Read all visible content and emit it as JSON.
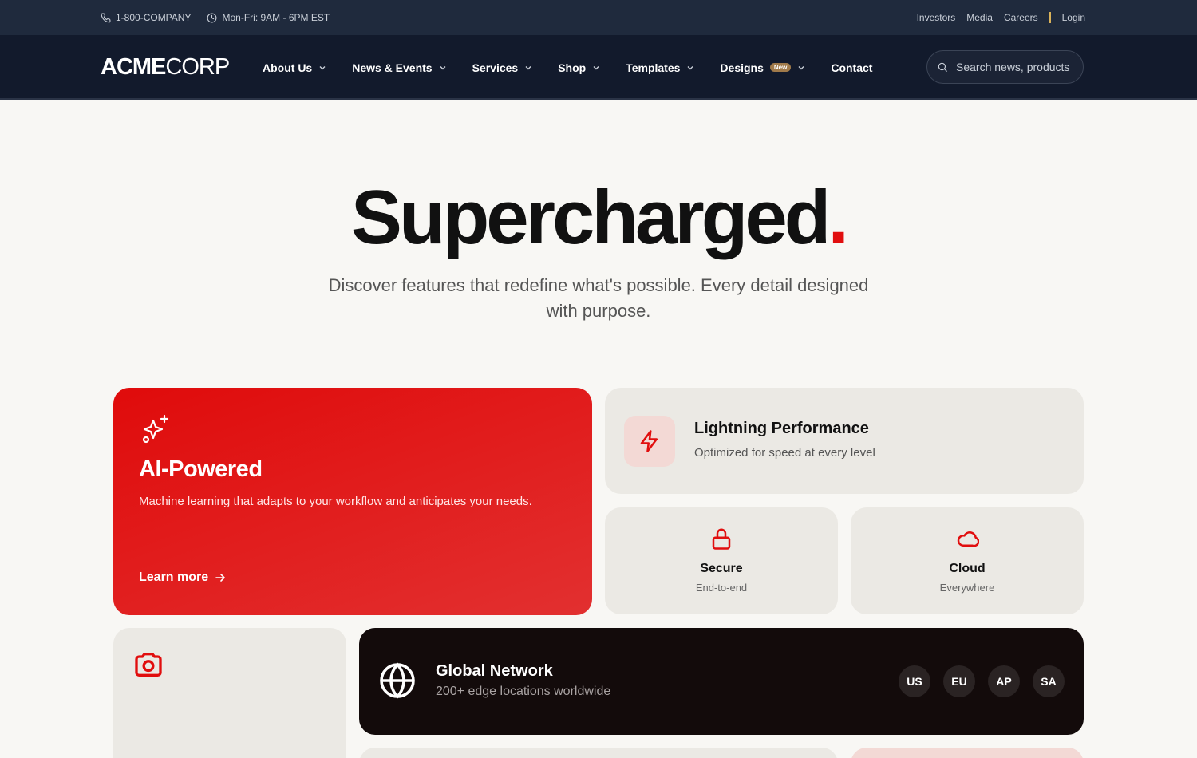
{
  "utility": {
    "phone": "1-800-COMPANY",
    "hours": "Mon-Fri: 9AM - 6PM EST",
    "links": [
      "Investors",
      "Media",
      "Careers"
    ],
    "login": "Login"
  },
  "nav": {
    "logo_bold": "ACME",
    "logo_light": "CORP",
    "items": [
      {
        "label": "About Us",
        "dropdown": true
      },
      {
        "label": "News & Events",
        "dropdown": true
      },
      {
        "label": "Services",
        "dropdown": true
      },
      {
        "label": "Shop",
        "dropdown": true
      },
      {
        "label": "Templates",
        "dropdown": true
      },
      {
        "label": "Designs",
        "dropdown": true,
        "badge": "New"
      },
      {
        "label": "Contact",
        "dropdown": false
      }
    ],
    "search_placeholder": "Search news, products..."
  },
  "hero": {
    "title": "Supercharged",
    "title_dot": ".",
    "subtitle": "Discover features that redefine what's possible. Every detail designed with purpose."
  },
  "features": {
    "ai": {
      "icon": "sparkles-icon",
      "title": "AI-Powered",
      "description": "Machine learning that adapts to your workflow and anticipates your needs.",
      "link": "Learn more"
    },
    "performance": {
      "icon": "lightning-icon",
      "title": "Lightning Performance",
      "subtitle": "Optimized for speed at every level"
    },
    "secure": {
      "icon": "lock-icon",
      "title": "Secure",
      "subtitle": "End-to-end"
    },
    "cloud": {
      "icon": "cloud-icon",
      "title": "Cloud",
      "subtitle": "Everywhere"
    },
    "camera": {
      "icon": "camera-icon"
    },
    "network": {
      "icon": "globe-icon",
      "title": "Global Network",
      "subtitle": "200+ edge locations worldwide",
      "regions": [
        "US",
        "EU",
        "AP",
        "SA"
      ]
    }
  },
  "colors": {
    "accent": "#e10e0e",
    "nav_bg": "#121a2c",
    "utility_bg": "#1f2a3d",
    "page_bg": "#f8f7f4",
    "card_bg": "#ebe9e4",
    "dark_card_bg": "#130b0b",
    "badge_bg": "#a07a4a"
  }
}
